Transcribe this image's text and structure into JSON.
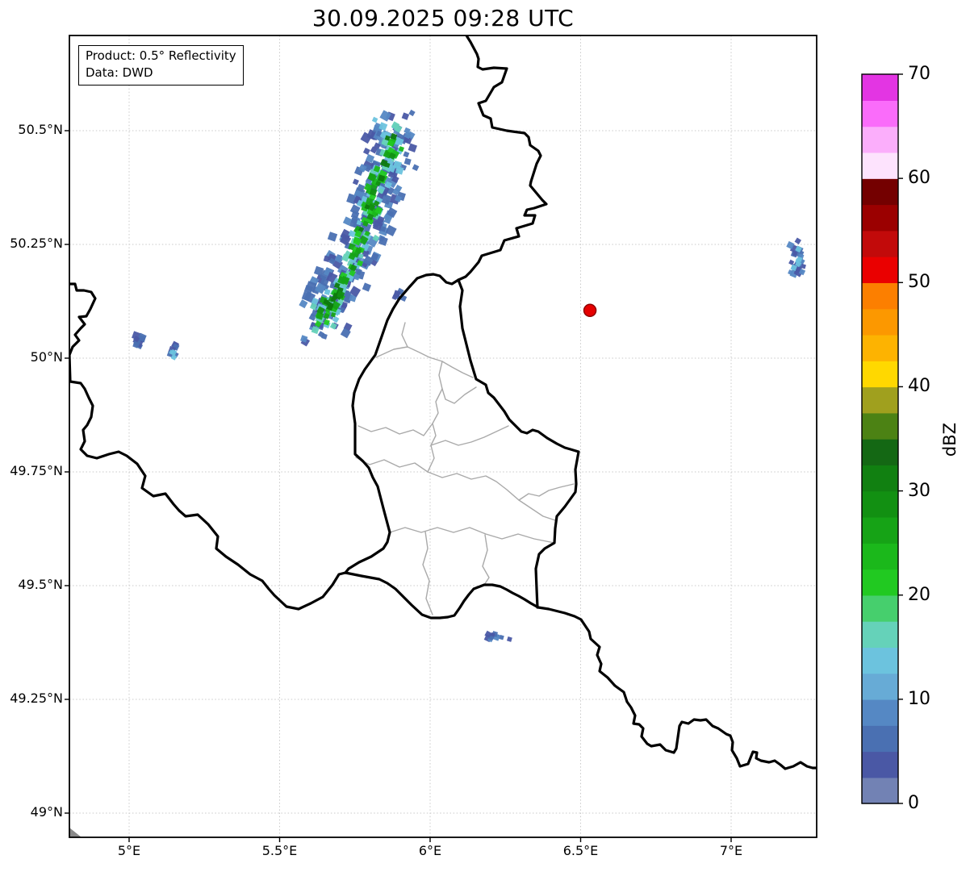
{
  "title": "30.09.2025 09:28 UTC",
  "annotation": {
    "product_label": "Product: 0.5° Reflectivity",
    "source_label": "Data: DWD"
  },
  "map": {
    "x_axis": {
      "ticks": [
        {
          "label": "5°E",
          "lon": 5.0
        },
        {
          "label": "5.5°E",
          "lon": 5.5
        },
        {
          "label": "6°E",
          "lon": 6.0
        },
        {
          "label": "6.5°E",
          "lon": 6.5
        },
        {
          "label": "7°E",
          "lon": 7.0
        }
      ]
    },
    "y_axis": {
      "ticks": [
        {
          "label": "50.5°N",
          "lat": 50.5
        },
        {
          "label": "50.25°N",
          "lat": 50.25
        },
        {
          "label": "50°N",
          "lat": 50.0
        },
        {
          "label": "49.75°N",
          "lat": 49.75
        },
        {
          "label": "49.5°N",
          "lat": 49.5
        },
        {
          "label": "49.25°N",
          "lat": 49.25
        },
        {
          "label": "49°N",
          "lat": 49.0
        }
      ]
    }
  },
  "marker": {
    "name": "radar-site-marker",
    "lon": 6.531,
    "lat": 50.105,
    "color": "#e60000",
    "edge_color": "#8f0000",
    "radius_px": 7.5
  },
  "colorbar": {
    "label": "dBZ",
    "min": 0,
    "max": 70,
    "step": 2.5,
    "tick_values": [
      0,
      10,
      20,
      30,
      40,
      50,
      60,
      70
    ],
    "tick_labels": [
      "0",
      "10",
      "20",
      "30",
      "40",
      "50",
      "60",
      "70"
    ],
    "colors_bottom_to_top": [
      "#7282b4",
      "#4a58a5",
      "#4a70b2",
      "#5588c4",
      "#67abd6",
      "#6cc3de",
      "#65d2b9",
      "#46cf6d",
      "#21c921",
      "#1bb81b",
      "#16a316",
      "#129012",
      "#118011",
      "#146814",
      "#4c8214",
      "#a0a01e",
      "#ffd800",
      "#fdb301",
      "#fc9800",
      "#fc7f00",
      "#ea0000",
      "#c20a0a",
      "#9b0000",
      "#740000",
      "#fde3fd",
      "#fbaefb",
      "#fa6cfa",
      "#e335e3"
    ]
  },
  "colors": {
    "country_border": "#000000",
    "canton_border": "#a9a9a9",
    "gridline": "#c9c9c9",
    "plot_bg": "#ffffff",
    "wedge": "#8a8a8a",
    "text": "#000000"
  },
  "chart_data": {
    "type": "radar_reflectivity_map",
    "unit": "dBZ",
    "value_range": [
      0,
      70
    ],
    "echo_clusters": [
      {
        "name": "main-storm-band",
        "seed": 11,
        "spine_lonlat": [
          [
            5.853,
            50.504
          ],
          [
            5.885,
            50.459
          ],
          [
            5.836,
            50.406
          ],
          [
            5.812,
            50.353
          ],
          [
            5.791,
            50.305
          ],
          [
            5.767,
            50.255
          ],
          [
            5.735,
            50.202
          ],
          [
            5.7,
            50.154
          ],
          [
            5.662,
            50.117
          ],
          [
            5.633,
            50.074
          ]
        ],
        "layers": [
          {
            "palette": [
              "#4a70b2",
              "#5588c4",
              "#4a58a5"
            ],
            "spread": 27,
            "cells": 240,
            "size": [
              6,
              11
            ]
          },
          {
            "palette": [
              "#6cc3de",
              "#65d2b9"
            ],
            "spread": 15,
            "cells": 95,
            "size": [
              5,
              9
            ]
          },
          {
            "palette": [
              "#21c921",
              "#1bb81b",
              "#16a316"
            ],
            "spread": 9,
            "cells": 72,
            "size": [
              5,
              9
            ]
          },
          {
            "palette": [
              "#129012",
              "#0e7a0e"
            ],
            "spread": 5,
            "cells": 26,
            "size": [
              5,
              8
            ]
          }
        ]
      },
      {
        "name": "main-band-outlier",
        "seed": 17,
        "spine_lonlat": [
          [
            5.895,
            50.145
          ],
          [
            5.911,
            50.128
          ]
        ],
        "layers": [
          {
            "palette": [
              "#4a70b2",
              "#4a58a5"
            ],
            "spread": 6,
            "cells": 6,
            "size": [
              4,
              8
            ]
          }
        ]
      },
      {
        "name": "east-edge-cell",
        "seed": 3,
        "spine_lonlat": [
          [
            7.214,
            50.245
          ],
          [
            7.225,
            50.22
          ],
          [
            7.214,
            50.195
          ]
        ],
        "layers": [
          {
            "palette": [
              "#4a70b2",
              "#4a58a5",
              "#5588c4"
            ],
            "spread": 8,
            "cells": 20,
            "size": [
              5,
              9
            ]
          },
          {
            "palette": [
              "#6cc3de"
            ],
            "spread": 4,
            "cells": 5,
            "size": [
              5,
              8
            ]
          }
        ]
      },
      {
        "name": "west-cell-1",
        "seed": 5,
        "spine_lonlat": [
          [
            5.032,
            50.057
          ],
          [
            5.038,
            50.027
          ]
        ],
        "layers": [
          {
            "palette": [
              "#4a58a5",
              "#4a70b2"
            ],
            "spread": 5,
            "cells": 10,
            "size": [
              5,
              9
            ]
          }
        ]
      },
      {
        "name": "west-cell-2",
        "seed": 9,
        "spine_lonlat": [
          [
            5.145,
            50.028
          ],
          [
            5.147,
            50.002
          ]
        ],
        "layers": [
          {
            "palette": [
              "#4a70b2",
              "#4a58a5"
            ],
            "spread": 4,
            "cells": 7,
            "size": [
              4,
              8
            ]
          },
          {
            "palette": [
              "#6cc3de"
            ],
            "spread": 3,
            "cells": 3,
            "size": [
              4,
              7
            ]
          }
        ]
      },
      {
        "name": "south-cell",
        "seed": 13,
        "spine_lonlat": [
          [
            6.19,
            49.387
          ],
          [
            6.257,
            49.374
          ]
        ],
        "layers": [
          {
            "palette": [
              "#4a70b2",
              "#5588c4",
              "#4a58a5"
            ],
            "spread": 5,
            "cells": 11,
            "size": [
              4,
              8
            ]
          }
        ]
      }
    ]
  }
}
